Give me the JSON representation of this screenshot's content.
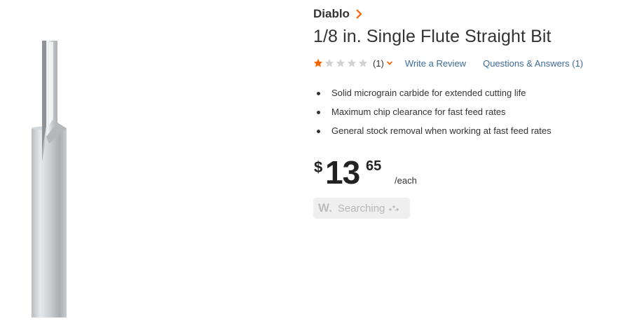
{
  "product": {
    "brand": "Diablo",
    "title": "1/8 in. Single Flute Straight Bit",
    "rating": {
      "stars_filled": 1,
      "stars_total": 5,
      "count_text": "(1)"
    },
    "write_review_label": "Write a Review",
    "qa_label": "Questions & Answers (1)",
    "bullets": [
      "Solid micrograin carbide for extended cutting life",
      "Maximum chip clearance for fast feed rates",
      "General stock removal when working at fast feed rates"
    ],
    "price": {
      "currency": "$",
      "dollars": "13",
      "cents": "65",
      "unit": "/each"
    }
  },
  "widget": {
    "logo": "W.",
    "status": "Searching",
    "icon": "loading-dots-icon"
  },
  "colors": {
    "accent": "#f96302",
    "link": "#3d6b99",
    "text": "#333333"
  }
}
